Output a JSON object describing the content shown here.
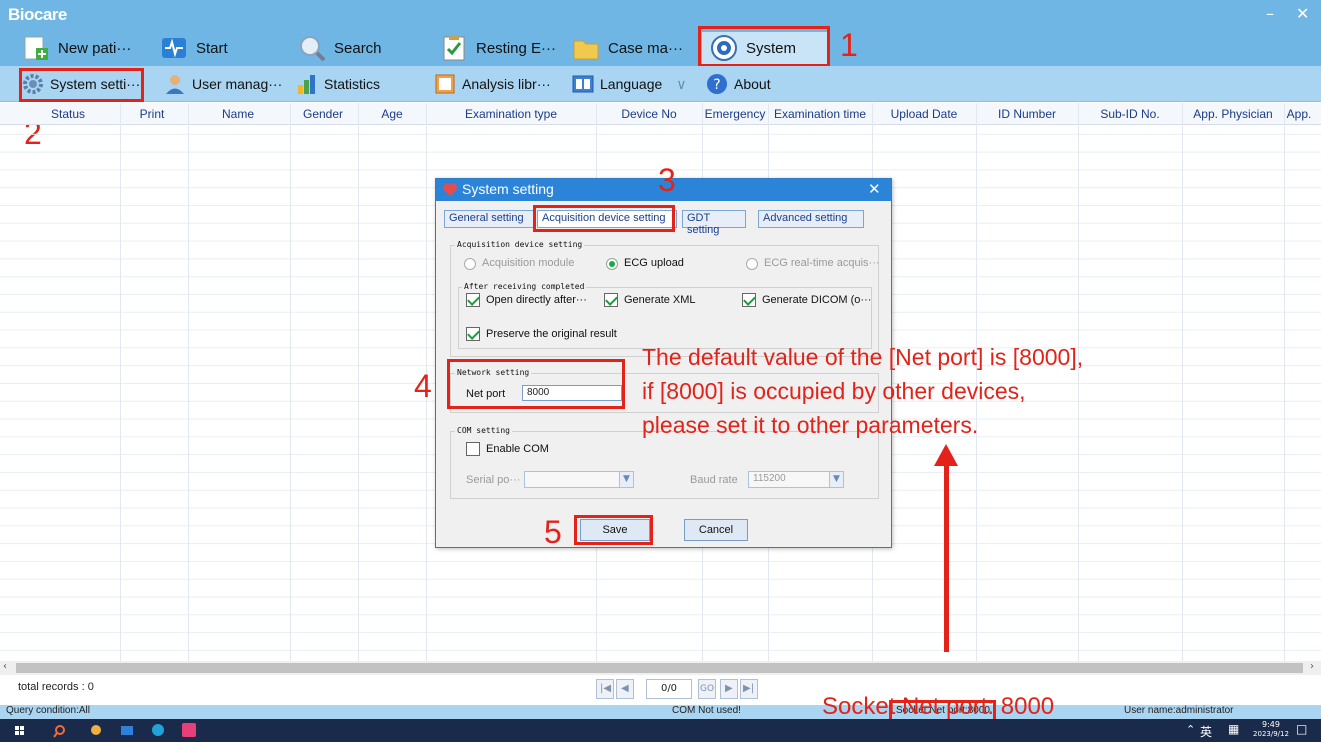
{
  "app": {
    "logo": "Biocare"
  },
  "ribbon": {
    "items": [
      {
        "label": "New pati···",
        "icon": "new-patient-icon"
      },
      {
        "label": "Start",
        "icon": "start-icon"
      },
      {
        "label": "Search",
        "icon": "search-icon"
      },
      {
        "label": "Resting E···",
        "icon": "resting-ecg-icon"
      },
      {
        "label": "Case ma···",
        "icon": "folder-icon"
      },
      {
        "label": "System",
        "icon": "system-icon"
      }
    ]
  },
  "toolbar": {
    "items": [
      {
        "label": "System setti···",
        "icon": "gear-icon"
      },
      {
        "label": "User manag···",
        "icon": "user-icon"
      },
      {
        "label": "Statistics",
        "icon": "bar-chart-icon"
      },
      {
        "label": "Analysis libr···",
        "icon": "library-icon"
      },
      {
        "label": "Language",
        "icon": "language-icon"
      },
      {
        "label": "About",
        "icon": "help-icon"
      }
    ],
    "language_arrow": "∨"
  },
  "grid": {
    "columns": [
      "Status",
      "Print",
      "Name",
      "Gender",
      "Age",
      "Examination type",
      "Device No",
      "Emergency",
      "Examination time",
      "Upload Date",
      "ID Number",
      "Sub-ID No.",
      "App. Physician",
      "App."
    ]
  },
  "dialog": {
    "title": "System setting",
    "tabs": [
      "General setting",
      "Acquisition device setting",
      "GDT setting",
      "Advanced setting"
    ],
    "acq_group": "Acquisition device setting",
    "radio_module": "Acquisition module",
    "radio_upload": "ECG upload",
    "radio_realtime": "ECG real-time acquis···",
    "after_group": "After receiving completed",
    "chk_open": "Open directly after···",
    "chk_xml": "Generate XML",
    "chk_dicom": "Generate DICOM (o···",
    "chk_preserve": "Preserve the original result",
    "net_group": "Network setting",
    "net_port_label": "Net port",
    "net_port_value": "8000",
    "com_group": "COM setting",
    "chk_enable_com": "Enable COM",
    "serial_label": "Serial po···",
    "baud_label": "Baud rate",
    "baud_value": "115200",
    "save": "Save",
    "cancel": "Cancel"
  },
  "annotation": {
    "n1": "1",
    "n2": "2",
    "n3": "3",
    "n4": "4",
    "n5": "5",
    "note_line1": "The default value of the [Net port] is [8000],",
    "note_line2": "if [8000] is occupied by other devices,",
    "note_line3": "please set it to other parameters.",
    "socket_note": "Socket Net port: 8000"
  },
  "footer": {
    "total_records": "total records : 0",
    "page": "0/0",
    "go": "GO"
  },
  "status": {
    "query": "Query condition:All",
    "com": "COM Not used!",
    "socket": "Socket Net port:8000",
    "user": "User name:administrator"
  },
  "taskbar": {
    "ime": "英",
    "time": "9:49",
    "date": "2023/9/12"
  },
  "colors": {
    "accent": "#6fb6e4",
    "annotation": "#e32319",
    "dialog_title": "#2b84d8"
  }
}
